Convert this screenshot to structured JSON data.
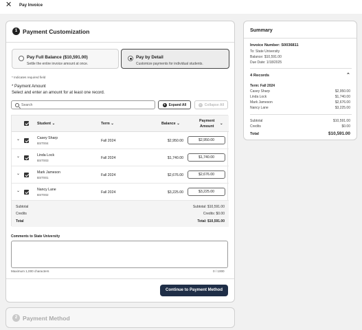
{
  "header": {
    "title": "Pay Invoice"
  },
  "step1": {
    "number": "1",
    "title": "Payment Customization",
    "options": [
      {
        "title": "Pay Full Balance ($10,591.00)",
        "subtitle": "Settle the entire invoice amount at once.",
        "selected": false
      },
      {
        "title": "Pay by Detail",
        "subtitle": "Customize payments for individual students.",
        "selected": true
      }
    ],
    "required_note": "* Indicates required field",
    "payment_amount_label": "* Payment Amount",
    "instructions": "Select and enter an amount for at least one record.",
    "search_placeholder": "Search",
    "expand_all": "Expand All",
    "collapse_all": "Collapse All"
  },
  "table": {
    "headers": {
      "student": "Student",
      "term": "Term",
      "balance": "Balance",
      "payment_line1": "Payment",
      "payment_line2": "Amount"
    },
    "rows": [
      {
        "name": "Casey Sharp",
        "id": "BST004",
        "term": "Fall 2024",
        "balance": "$2,950.00",
        "amount": "$2,950.00"
      },
      {
        "name": "Linda Lock",
        "id": "BST003",
        "term": "Fall 2024",
        "balance": "$1,740.00",
        "amount": "$1,740.00"
      },
      {
        "name": "Mark Jameson",
        "id": "BST001",
        "term": "Fall 2024",
        "balance": "$2,676.00",
        "amount": "$2,676.00"
      },
      {
        "name": "Nancy Lane",
        "id": "BST002",
        "term": "Fall 2024",
        "balance": "$3,225.00",
        "amount": "$3,225.00"
      }
    ],
    "footer": {
      "subtotal_label": "Subtotal",
      "credits_label": "Credits",
      "total_label": "Total",
      "subtotal_value": "Subtotal: $10,591.00",
      "credits_value": "Credits: $0.00",
      "total_value": "Total: $10,591.00"
    }
  },
  "comments": {
    "label": "Comments to State University",
    "hint": "Maximum 1,000 characters",
    "counter": "0 / 1000",
    "value": ""
  },
  "continue_button": "Continue to Payment Method",
  "step2": {
    "number": "2",
    "title": "Payment Method"
  },
  "summary": {
    "title": "Summary",
    "invoice_number": "Invoice Number: S0036811",
    "to": "To: State University",
    "balance": "Balance: $10,591.00",
    "due_date": "Due Date: 1/18/2025",
    "records_label": "4 Records",
    "term": "Term: Fall 2024",
    "items": [
      {
        "name": "Casey Sharp",
        "amount": "$2,950.00"
      },
      {
        "name": "Linda Lock",
        "amount": "$1,740.00"
      },
      {
        "name": "Mark Jameson",
        "amount": "$2,676.00"
      },
      {
        "name": "Nancy Lane",
        "amount": "$3,225.00"
      }
    ],
    "subtotal_label": "Subtotal",
    "subtotal": "$10,591.00",
    "credits_label": "Credits",
    "credits": "$0.00",
    "total_label": "Total",
    "total": "$10,591.00"
  },
  "icons": {
    "close": "close-icon",
    "search": "search-icon",
    "sort": "sort-chevron-icon",
    "expand": "chevron-down-icon",
    "collapse_summary": "chevron-up-icon",
    "checkbox": "checkbox-checked-icon"
  },
  "colors": {
    "primary": "#1f2e47",
    "text": "#1f1f1f",
    "muted": "#555555"
  }
}
